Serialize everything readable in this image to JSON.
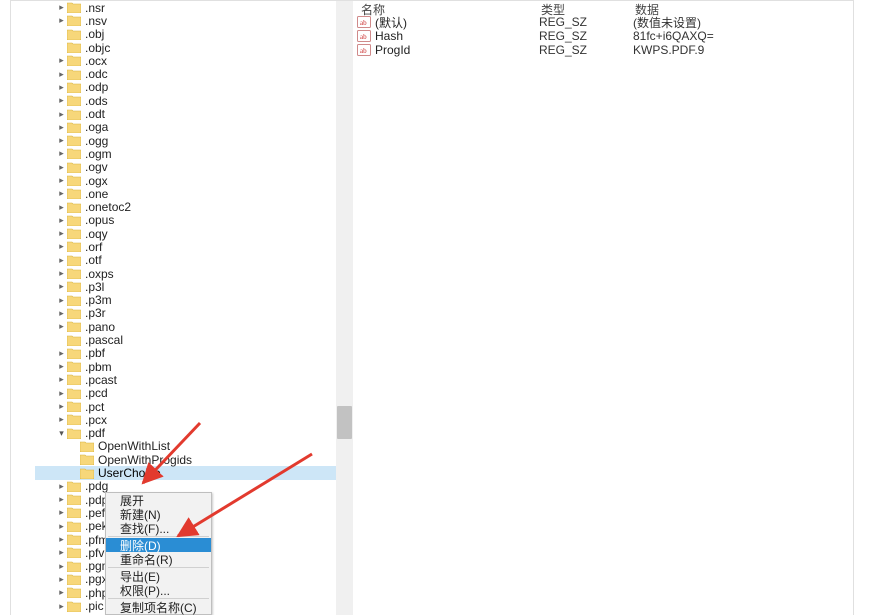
{
  "tree_items": [
    {
      "label": ".nsr",
      "indent": 0,
      "expandable": true,
      "expanded": false
    },
    {
      "label": ".nsv",
      "indent": 0,
      "expandable": true,
      "expanded": false
    },
    {
      "label": ".obj",
      "indent": 0,
      "expandable": false,
      "expanded": false
    },
    {
      "label": ".objc",
      "indent": 0,
      "expandable": false,
      "expanded": false
    },
    {
      "label": ".ocx",
      "indent": 0,
      "expandable": true,
      "expanded": false
    },
    {
      "label": ".odc",
      "indent": 0,
      "expandable": true,
      "expanded": false
    },
    {
      "label": ".odp",
      "indent": 0,
      "expandable": true,
      "expanded": false
    },
    {
      "label": ".ods",
      "indent": 0,
      "expandable": true,
      "expanded": false
    },
    {
      "label": ".odt",
      "indent": 0,
      "expandable": true,
      "expanded": false
    },
    {
      "label": ".oga",
      "indent": 0,
      "expandable": true,
      "expanded": false
    },
    {
      "label": ".ogg",
      "indent": 0,
      "expandable": true,
      "expanded": false
    },
    {
      "label": ".ogm",
      "indent": 0,
      "expandable": true,
      "expanded": false
    },
    {
      "label": ".ogv",
      "indent": 0,
      "expandable": true,
      "expanded": false
    },
    {
      "label": ".ogx",
      "indent": 0,
      "expandable": true,
      "expanded": false
    },
    {
      "label": ".one",
      "indent": 0,
      "expandable": true,
      "expanded": false
    },
    {
      "label": ".onetoc2",
      "indent": 0,
      "expandable": true,
      "expanded": false
    },
    {
      "label": ".opus",
      "indent": 0,
      "expandable": true,
      "expanded": false
    },
    {
      "label": ".oqy",
      "indent": 0,
      "expandable": true,
      "expanded": false
    },
    {
      "label": ".orf",
      "indent": 0,
      "expandable": true,
      "expanded": false
    },
    {
      "label": ".otf",
      "indent": 0,
      "expandable": true,
      "expanded": false
    },
    {
      "label": ".oxps",
      "indent": 0,
      "expandable": true,
      "expanded": false
    },
    {
      "label": ".p3l",
      "indent": 0,
      "expandable": true,
      "expanded": false
    },
    {
      "label": ".p3m",
      "indent": 0,
      "expandable": true,
      "expanded": false
    },
    {
      "label": ".p3r",
      "indent": 0,
      "expandable": true,
      "expanded": false
    },
    {
      "label": ".pano",
      "indent": 0,
      "expandable": true,
      "expanded": false
    },
    {
      "label": ".pascal",
      "indent": 0,
      "expandable": false,
      "expanded": false
    },
    {
      "label": ".pbf",
      "indent": 0,
      "expandable": true,
      "expanded": false
    },
    {
      "label": ".pbm",
      "indent": 0,
      "expandable": true,
      "expanded": false
    },
    {
      "label": ".pcast",
      "indent": 0,
      "expandable": true,
      "expanded": false
    },
    {
      "label": ".pcd",
      "indent": 0,
      "expandable": true,
      "expanded": false
    },
    {
      "label": ".pct",
      "indent": 0,
      "expandable": true,
      "expanded": false
    },
    {
      "label": ".pcx",
      "indent": 0,
      "expandable": true,
      "expanded": false
    },
    {
      "label": ".pdf",
      "indent": 0,
      "expandable": true,
      "expanded": true
    },
    {
      "label": "OpenWithList",
      "indent": 1,
      "expandable": false,
      "expanded": false
    },
    {
      "label": "OpenWithProgids",
      "indent": 1,
      "expandable": false,
      "expanded": false
    },
    {
      "label": "UserChoice",
      "indent": 1,
      "expandable": false,
      "expanded": false,
      "selected": true
    },
    {
      "label": ".pdg",
      "indent": 0,
      "expandable": true,
      "expanded": false
    },
    {
      "label": ".pdp",
      "indent": 0,
      "expandable": true,
      "expanded": false
    },
    {
      "label": ".pef",
      "indent": 0,
      "expandable": true,
      "expanded": false
    },
    {
      "label": ".pek",
      "indent": 0,
      "expandable": true,
      "expanded": false
    },
    {
      "label": ".pfm",
      "indent": 0,
      "expandable": true,
      "expanded": false
    },
    {
      "label": ".pfv",
      "indent": 0,
      "expandable": true,
      "expanded": false
    },
    {
      "label": ".pgm",
      "indent": 0,
      "expandable": true,
      "expanded": false
    },
    {
      "label": ".pgx",
      "indent": 0,
      "expandable": true,
      "expanded": false
    },
    {
      "label": ".php",
      "indent": 0,
      "expandable": true,
      "expanded": false
    },
    {
      "label": ".pic",
      "indent": 0,
      "expandable": true,
      "expanded": false
    }
  ],
  "columns": {
    "name": "名称",
    "type": "类型",
    "data": "数据"
  },
  "values": [
    {
      "name": "(默认)",
      "type": "REG_SZ",
      "data": "(数值未设置)"
    },
    {
      "name": "Hash",
      "type": "REG_SZ",
      "data": "81fc+i6QAXQ="
    },
    {
      "name": "ProgId",
      "type": "REG_SZ",
      "data": "KWPS.PDF.9"
    }
  ],
  "ctx": {
    "items": [
      {
        "label": "展开"
      },
      {
        "label": "新建(N)"
      },
      {
        "label": "查找(F)..."
      },
      {
        "label": "删除(D)",
        "hovered": true
      },
      {
        "label": "重命名(R)"
      },
      {
        "label": "导出(E)"
      },
      {
        "label": "权限(P)..."
      },
      {
        "label": "复制项名称(C)"
      }
    ]
  }
}
